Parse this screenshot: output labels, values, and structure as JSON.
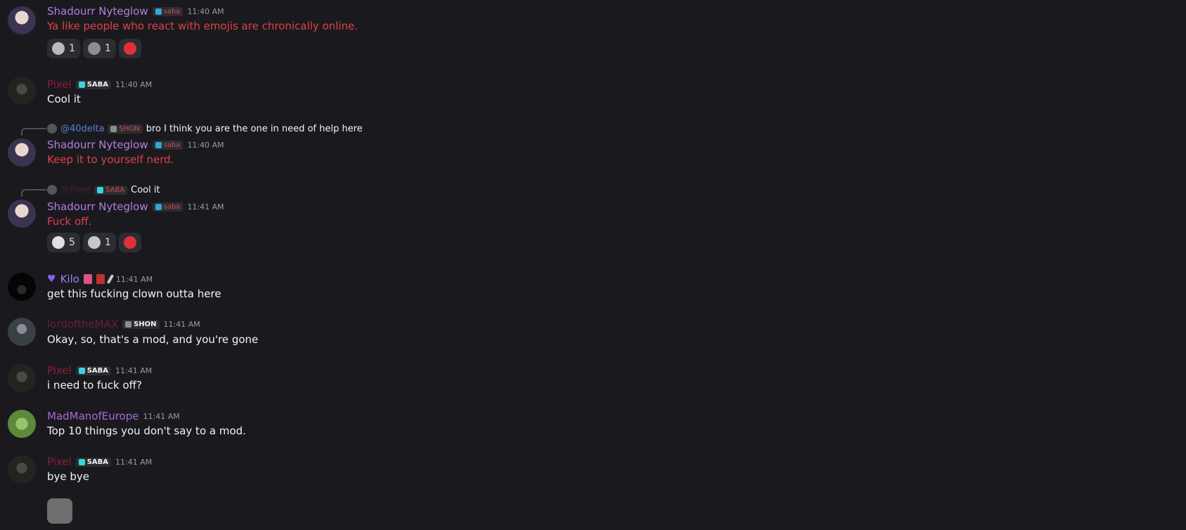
{
  "messages": [
    {
      "author": "Shadourr Nyteglow",
      "tag": "saba",
      "time": "11:40 AM",
      "text": "Ya like people who react with emojis are chronically online.",
      "reactions": [
        {
          "emoji": "sticker-emoji",
          "count": "1"
        },
        {
          "emoji": "sticker-emoji",
          "count": "1"
        },
        {
          "emoji": "add-reaction-icon",
          "count": ""
        }
      ]
    },
    {
      "author": "Pixel",
      "tag": "SABA",
      "time": "11:40 AM",
      "text": "Cool it"
    },
    {
      "reply": {
        "mention": "@40delta",
        "tag": "SHON",
        "text": "bro I think you are the one in need of help here"
      },
      "author": "Shadourr Nyteglow",
      "tag": "saba",
      "time": "11:40 AM",
      "text": "Keep it to yourself nerd."
    },
    {
      "reply": {
        "mention": "@Pixel",
        "tag": "SABA",
        "text": "Cool it"
      },
      "author": "Shadourr Nyteglow",
      "tag": "saba",
      "time": "11:41 AM",
      "text": "Fuck off.",
      "reactions": [
        {
          "emoji": "sticker-emoji",
          "count": "5"
        },
        {
          "emoji": "sticker-emoji",
          "count": "1"
        },
        {
          "emoji": "add-reaction-icon",
          "count": ""
        }
      ]
    },
    {
      "author": "Kilo",
      "time": "11:41 AM",
      "text": "get this fucking clown outta here"
    },
    {
      "author": "lordoftheMAX",
      "tag": "SHON",
      "time": "11:41 AM",
      "text": "Okay, so, that's a mod, and you're gone"
    },
    {
      "author": "Pixel",
      "tag": "SABA",
      "time": "11:41 AM",
      "text": "i need to fuck off?"
    },
    {
      "author": "MadManofEurope",
      "time": "11:41 AM",
      "text": "Top 10 things you don't say to a mod."
    },
    {
      "author": "Pixel",
      "tag": "SABA",
      "time": "11:41 AM",
      "text": "bye bye"
    }
  ],
  "colors": {
    "background": "#1a1a1e",
    "shadow_name": "#b37ee0",
    "red_text": "#e0404a",
    "pixel_name": "#8a1c3a",
    "kilo_name": "#a07cf0",
    "mad_name": "#a46ad8"
  }
}
